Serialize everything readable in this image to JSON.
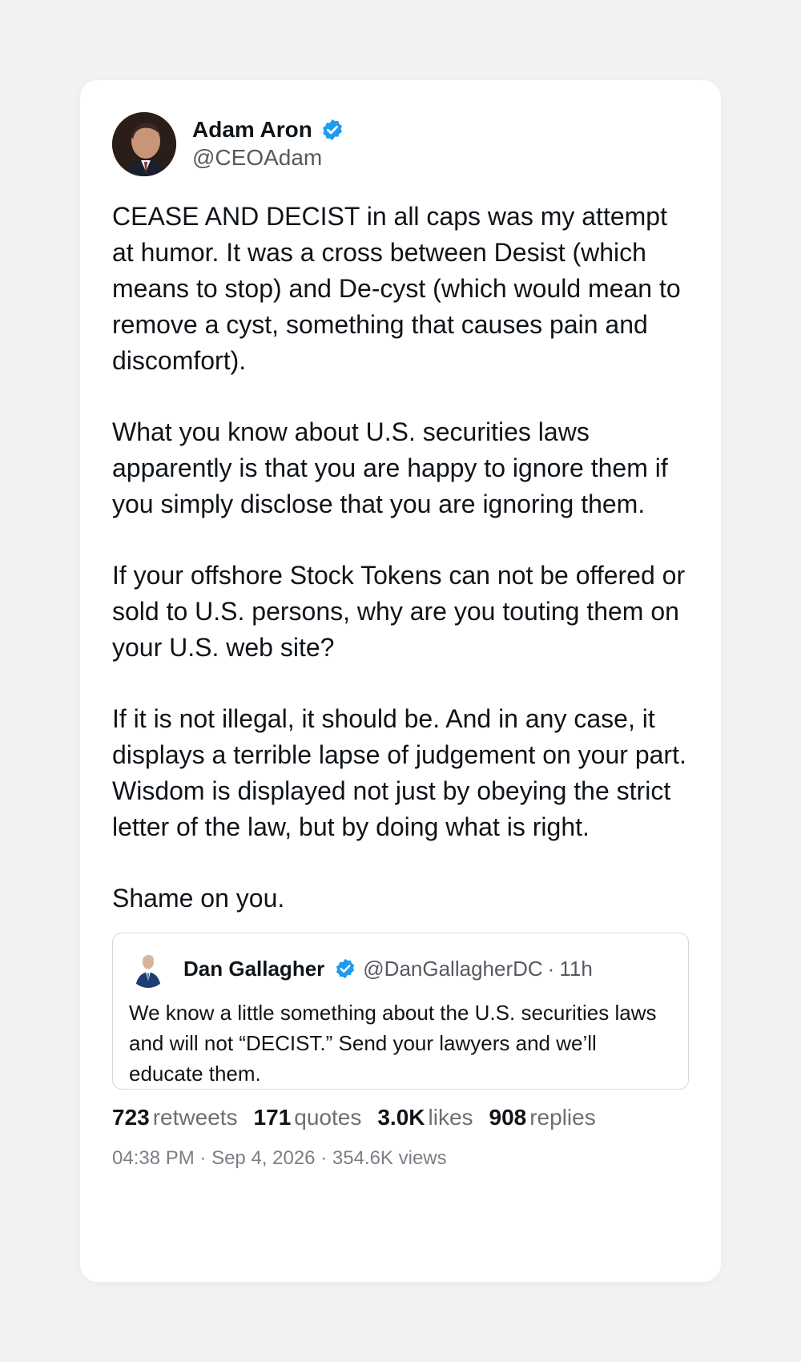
{
  "author": {
    "display_name": "Adam Aron",
    "handle": "@CEOAdam",
    "verified": true
  },
  "body": {
    "paragraphs": [
      "CEASE AND DECIST in all caps was my attempt at humor.  It was a cross between Desist (which means to stop) and De-cyst (which would mean to remove a cyst, something that causes pain and discomfort).",
      "What you know about U.S. securities laws apparently is that you are happy to ignore them if you simply disclose that you are ignoring them.",
      "If your offshore Stock Tokens can not be offered or sold to U.S. persons, why are you touting them on your U.S. web site?",
      "If it is not illegal, it should be. And in any case, it displays a terrible lapse of judgement on your part. Wisdom is displayed not just by obeying the strict letter of the law, but by doing what is right.",
      "Shame on you."
    ]
  },
  "quoted": {
    "display_name": "Dan Gallagher",
    "handle": "@DanGallagherDC",
    "separator": "·",
    "time": "11h",
    "text": "We know a little something about the U.S. securities laws and will not “DECIST.”  Send your lawyers and we’ll educate them."
  },
  "stats": {
    "retweets_num": "723",
    "retweets_label": "retweets",
    "quotes_num": "171",
    "quotes_label": "quotes",
    "likes_num": "3.0K",
    "likes_label": "likes",
    "replies_num": "908",
    "replies_label": "replies"
  },
  "meta": {
    "time": "04:38 PM",
    "date": "Sep 4, 2026",
    "views": "354.6K views",
    "separator": "·"
  },
  "colors": {
    "verified": "#1d9bf0",
    "page_bg": "#f2f2f3"
  },
  "icons": {
    "verified": "verified-badge-icon"
  }
}
